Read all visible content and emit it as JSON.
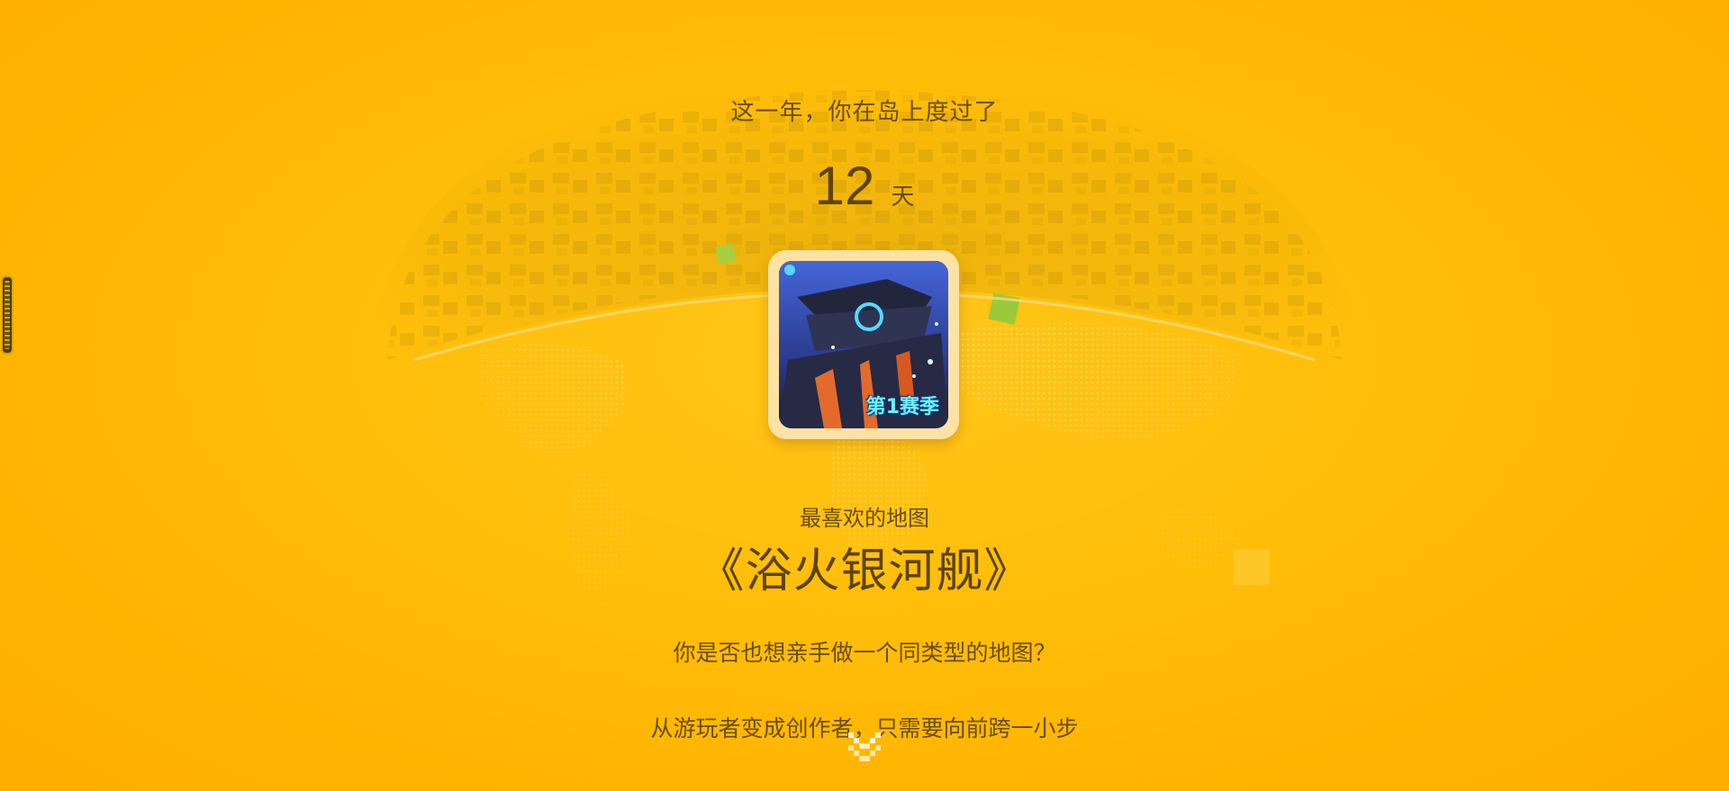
{
  "summary": {
    "intro_text": "这一年，你在岛上度过了",
    "days_value": "12",
    "days_unit": "天",
    "favorite_label": "最喜欢的地图",
    "favorite_map_title": "《浴火银河舰》",
    "map_badge": "第1赛季",
    "question_text": "你是否也想亲手做一个同类型的地图？",
    "slogan_text": "从游玩者变成创作者，只需要向前跨一小步"
  },
  "icons": {
    "scroll": "chevron-down-icon",
    "handle": "side-drag-handle"
  },
  "colors": {
    "background": "#ffbe0a",
    "text": "#5e4204",
    "badge": "#6cf1ff"
  }
}
